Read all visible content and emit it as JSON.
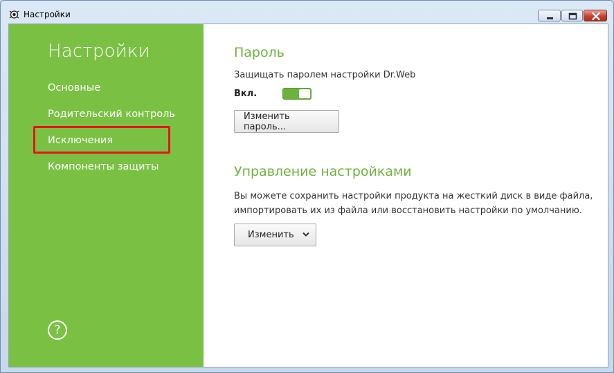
{
  "window": {
    "title": "Настройки",
    "controls": [
      "minimize",
      "maximize",
      "close"
    ]
  },
  "sidebar": {
    "title": "Настройки",
    "items": [
      {
        "label": "Основные"
      },
      {
        "label": "Родительский контроль"
      },
      {
        "label": "Исключения",
        "highlighted": true
      },
      {
        "label": "Компоненты защиты"
      }
    ],
    "help_symbol": "?",
    "color": "#7ac143"
  },
  "password": {
    "title": "Пароль",
    "description": "Защищать паролем настройки Dr.Web",
    "toggle_label": "Вкл.",
    "toggle_on": true,
    "change_button": "Изменить пароль..."
  },
  "settings_mgmt": {
    "title": "Управление настройками",
    "line1": "Вы можете сохранить настройки продукта на жесткий диск в виде файла,",
    "line2": "импортировать их из файла или восстановить настройки по умолчанию.",
    "change_button": "Изменить"
  },
  "colors": {
    "accent": "#6cb33e",
    "highlight_box": "#e8121b"
  }
}
